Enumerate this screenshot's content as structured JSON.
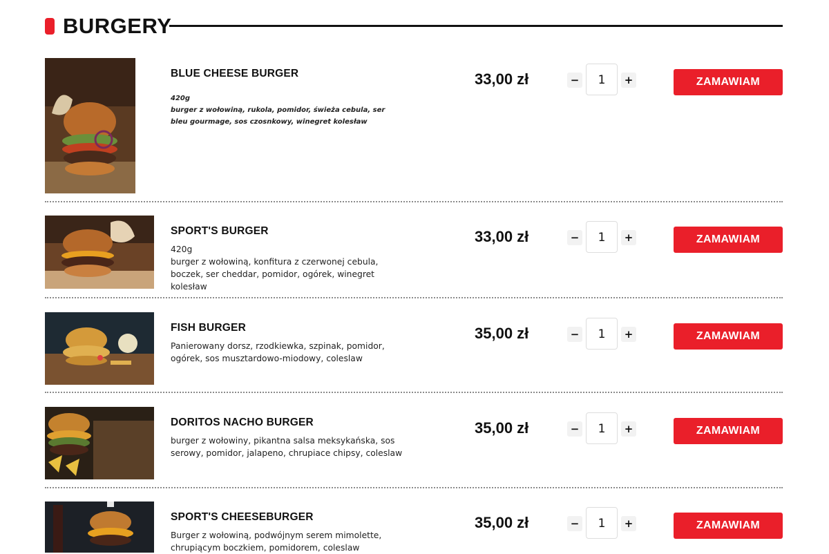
{
  "section": {
    "title": "BURGERY"
  },
  "items": [
    {
      "name": "BLUE CHEESE BURGER",
      "weight": "420g",
      "description": "burger z wołowiną, rukola, pomidor, świeża cebula, ser bleu gourmage, sos czosnkowy, winegret kolesław",
      "price": "33,00 zł",
      "quantity": "1",
      "button": "ZAMAWIAM"
    },
    {
      "name": "SPORT'S BURGER",
      "weight": "420g",
      "description": "burger z wołowiną, konfitura z czerwonej cebula, boczek, ser cheddar, pomidor, ogórek, winegret kolesław",
      "price": "33,00 zł",
      "quantity": "1",
      "button": "ZAMAWIAM"
    },
    {
      "name": "FISH BURGER",
      "description": "Panierowany dorsz, rzodkiewka, szpinak, pomidor, ogórek, sos musztardowo-miodowy, coleslaw",
      "price": "35,00 zł",
      "quantity": "1",
      "button": "ZAMAWIAM"
    },
    {
      "name": "DORITOS NACHO BURGER",
      "description": "burger z wołowiny, pikantna salsa meksykańska, sos serowy, pomidor, jalapeno, chrupiace chipsy, coleslaw",
      "price": "35,00 zł",
      "quantity": "1",
      "button": "ZAMAWIAM"
    },
    {
      "name": "SPORT'S CHEESEBURGER",
      "description": "Burger z wołowiną, podwójnym serem mimolette, chrupiącym boczkiem, pomidorem, coleslaw",
      "price": "35,00 zł",
      "quantity": "1",
      "button": "ZAMAWIAM"
    }
  ],
  "controls": {
    "minus": "−",
    "plus": "+"
  },
  "colors": {
    "accent": "#ea1f2a",
    "text": "#111111",
    "divider": "#8a8a8a"
  },
  "icons": {
    "minus": "minus-icon",
    "plus": "plus-icon"
  }
}
